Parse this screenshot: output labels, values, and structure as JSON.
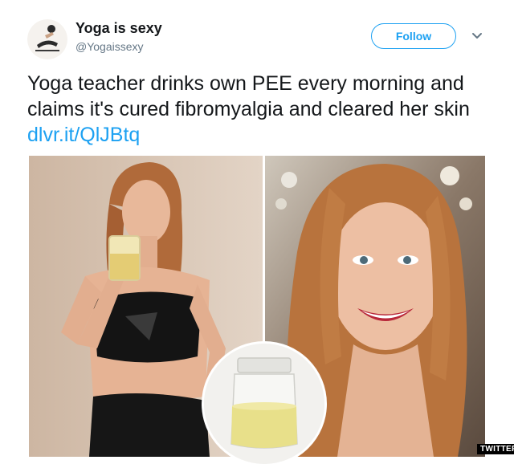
{
  "author": {
    "display_name": "Yoga is sexy",
    "handle": "@Yogaissexy"
  },
  "follow_button": {
    "label": "Follow"
  },
  "tweet": {
    "text": "Yoga teacher drinks own PEE every morning and claims it's cured fibromyalgia and cleared her skin",
    "link": "dlvr.it/QlJBtq"
  },
  "watermark": "TWITTER",
  "colors": {
    "accent": "#1da1f2",
    "text": "#14171a",
    "secondary_text": "#657786"
  },
  "icons": {
    "avatar": "yoga-pose-avatar",
    "caret": "chevron-down-icon"
  }
}
